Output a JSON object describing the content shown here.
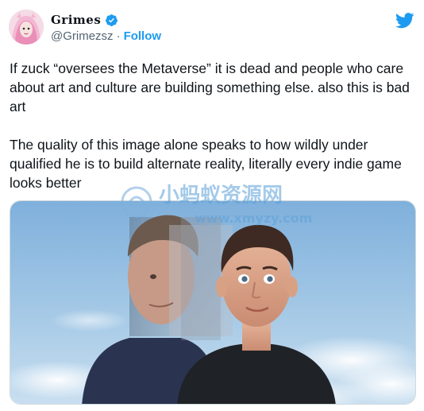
{
  "author": {
    "display_name": "Grimes",
    "handle": "@Grimezsz",
    "separator": "·",
    "follow_label": "Follow",
    "avatar_icon": "avatar-portrait-icon",
    "verified_icon": "verified-badge-icon"
  },
  "brand": {
    "icon": "twitter-bird-icon",
    "color": "#1d9bf0"
  },
  "tweet": {
    "paragraph_1": "If zuck “oversees the Metaverse” it is dead and people who care about art and culture are building something else. also this is bad art",
    "paragraph_2": "The quality of this image alone speaks to how wildly under qualified he is to build alternate reality, literally every indie game looks better"
  },
  "watermark": {
    "text_cn": "小蚂蚁资源网",
    "text_url": "www.xmyzy.com"
  },
  "colors": {
    "text": "#0f1419",
    "muted": "#536471",
    "link": "#1d9bf0"
  }
}
